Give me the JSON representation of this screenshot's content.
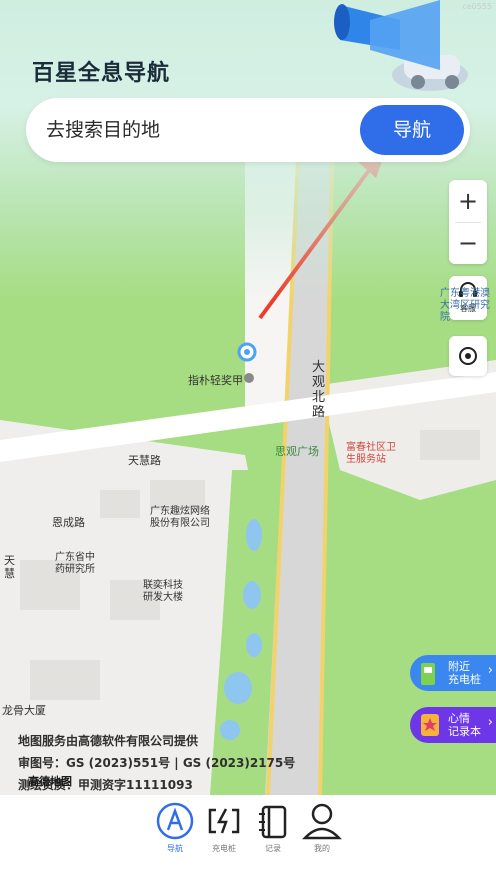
{
  "app": {
    "title": "百星全息导航",
    "watermark": "ce0555"
  },
  "search": {
    "placeholder": "去搜索目的地",
    "button_label": "导航"
  },
  "map_controls": {
    "zoom_in": "+",
    "zoom_out": "−",
    "service_label": "客服"
  },
  "promos": [
    {
      "line1": "附近",
      "line2": "充电桩",
      "color": "#3b87f0"
    },
    {
      "line1": "心情",
      "line2": "记录本",
      "color": "#6d37e8"
    }
  ],
  "map_labels": {
    "place_a": "指朴轻奖甲",
    "road_daguan": "大观北路",
    "road_tianhui": "天慧路",
    "road_enqi": "恩成路",
    "road_tianhui_v": "天慧",
    "siguan": "思观广场",
    "community": "富春社区卫生服务站",
    "company1": "广东趣炫网络股份有限公司",
    "institute": "广东省中药研究所",
    "company2": "联奕科技研发大楼",
    "building": "龙骨大厦",
    "east": "广东粤港澳大湾区研究院"
  },
  "attribution": {
    "provider": "地图服务由高德软件有限公司提供",
    "review": "审图号：GS (2023)551号 | GS (2023)2175号",
    "survey": "测绘资质：甲测资字11111093",
    "logo": "高德地图"
  },
  "tabs": [
    {
      "label": "导航",
      "active": true
    },
    {
      "label": "充电桩",
      "active": false
    },
    {
      "label": "记录",
      "active": false
    },
    {
      "label": "我的",
      "active": false
    }
  ]
}
